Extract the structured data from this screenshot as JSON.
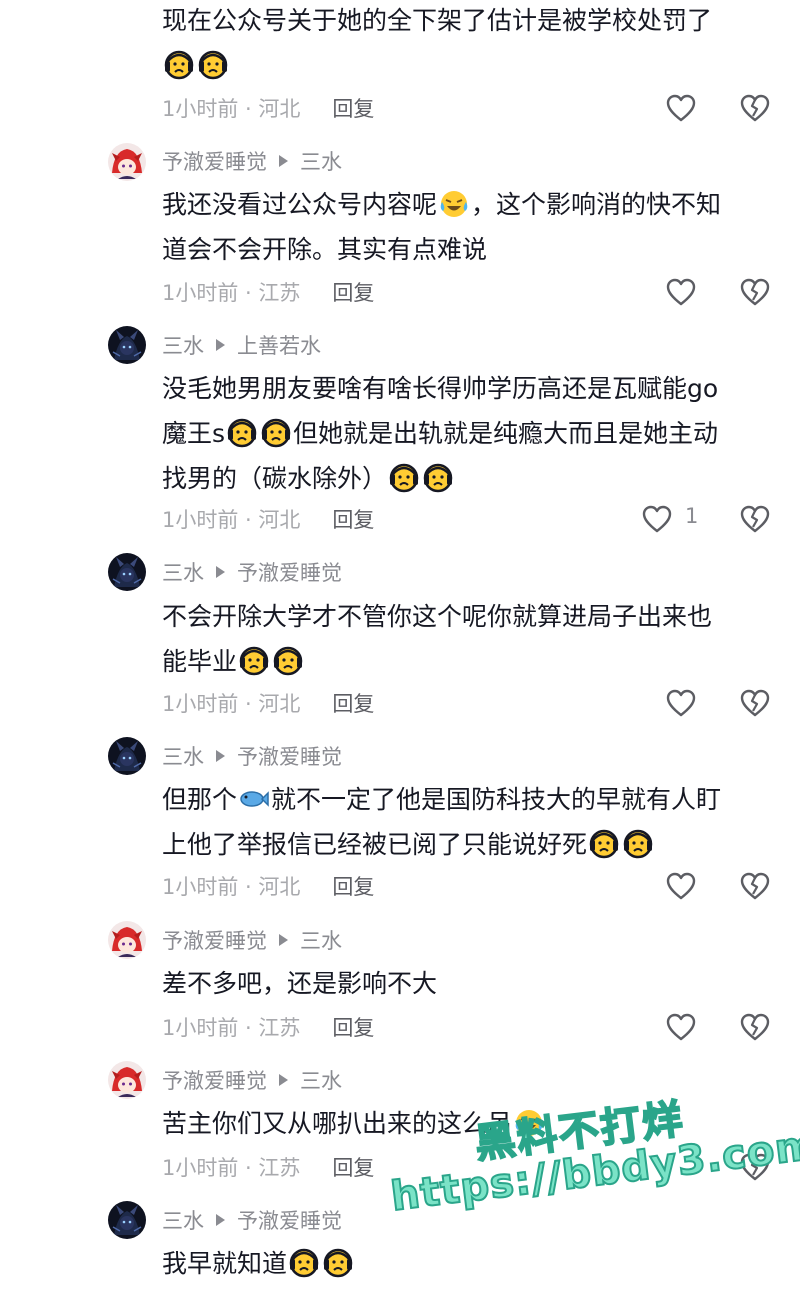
{
  "colors": {
    "text": "#161823",
    "meta": "#a8a9ad",
    "name": "#8a8b91",
    "watermark": "#7be3c7"
  },
  "comments": [
    {
      "lines": [
        "现在公众号关于她的全下架了估计是被学校处罚了",
        ""
      ],
      "time": "1小时前 · 河北",
      "reply": "回复",
      "like_count": ""
    },
    {
      "author": "予澈爱睡觉",
      "reply_to": "三水",
      "lines": [
        "我还没看过公众号内容呢",
        "，这个影响消的快不知",
        "道会不会开除。其实有点难说"
      ],
      "time": "1小时前 · 江苏",
      "reply": "回复",
      "like_count": ""
    },
    {
      "author": "三水",
      "reply_to": "上善若水",
      "lines": [
        "没毛她男朋友要啥有啥长得帅学历高还是瓦赋能go",
        "魔王s",
        "但她就是出轨就是纯瘾大而且是她主动",
        "找男的（碳水除外）"
      ],
      "time": "1小时前 · 河北",
      "reply": "回复",
      "like_count": "1"
    },
    {
      "author": "三水",
      "reply_to": "予澈爱睡觉",
      "lines": [
        "不会开除大学才不管你这个呢你就算进局子出来也",
        "能毕业"
      ],
      "time": "1小时前 · 河北",
      "reply": "回复",
      "like_count": ""
    },
    {
      "author": "三水",
      "reply_to": "予澈爱睡觉",
      "lines": [
        "但那个",
        "就不一定了他是国防科技大的早就有人盯",
        "上他了举报信已经被已阅了只能说好死"
      ],
      "time": "1小时前 · 河北",
      "reply": "回复",
      "like_count": ""
    },
    {
      "author": "予澈爱睡觉",
      "reply_to": "三水",
      "lines": [
        "差不多吧，还是影响不大"
      ],
      "time": "1小时前 · 江苏",
      "reply": "回复",
      "like_count": ""
    },
    {
      "author": "予澈爱睡觉",
      "reply_to": "三水",
      "lines": [
        "苦主你们又从哪扒出来的这么吊"
      ],
      "time": "1小时前 · 江苏",
      "reply": "回复",
      "like_count": ""
    },
    {
      "author": "三水",
      "reply_to": "予澈爱睡觉",
      "lines": [
        "我早就知道"
      ]
    }
  ],
  "watermark": {
    "line1": "黑料不打烊",
    "line2": "https://bbdy3.com"
  },
  "icons": [
    "heart-icon",
    "dislike-icon",
    "crying-face-emoji",
    "laughing-cry-emoji",
    "fish-emoji"
  ]
}
